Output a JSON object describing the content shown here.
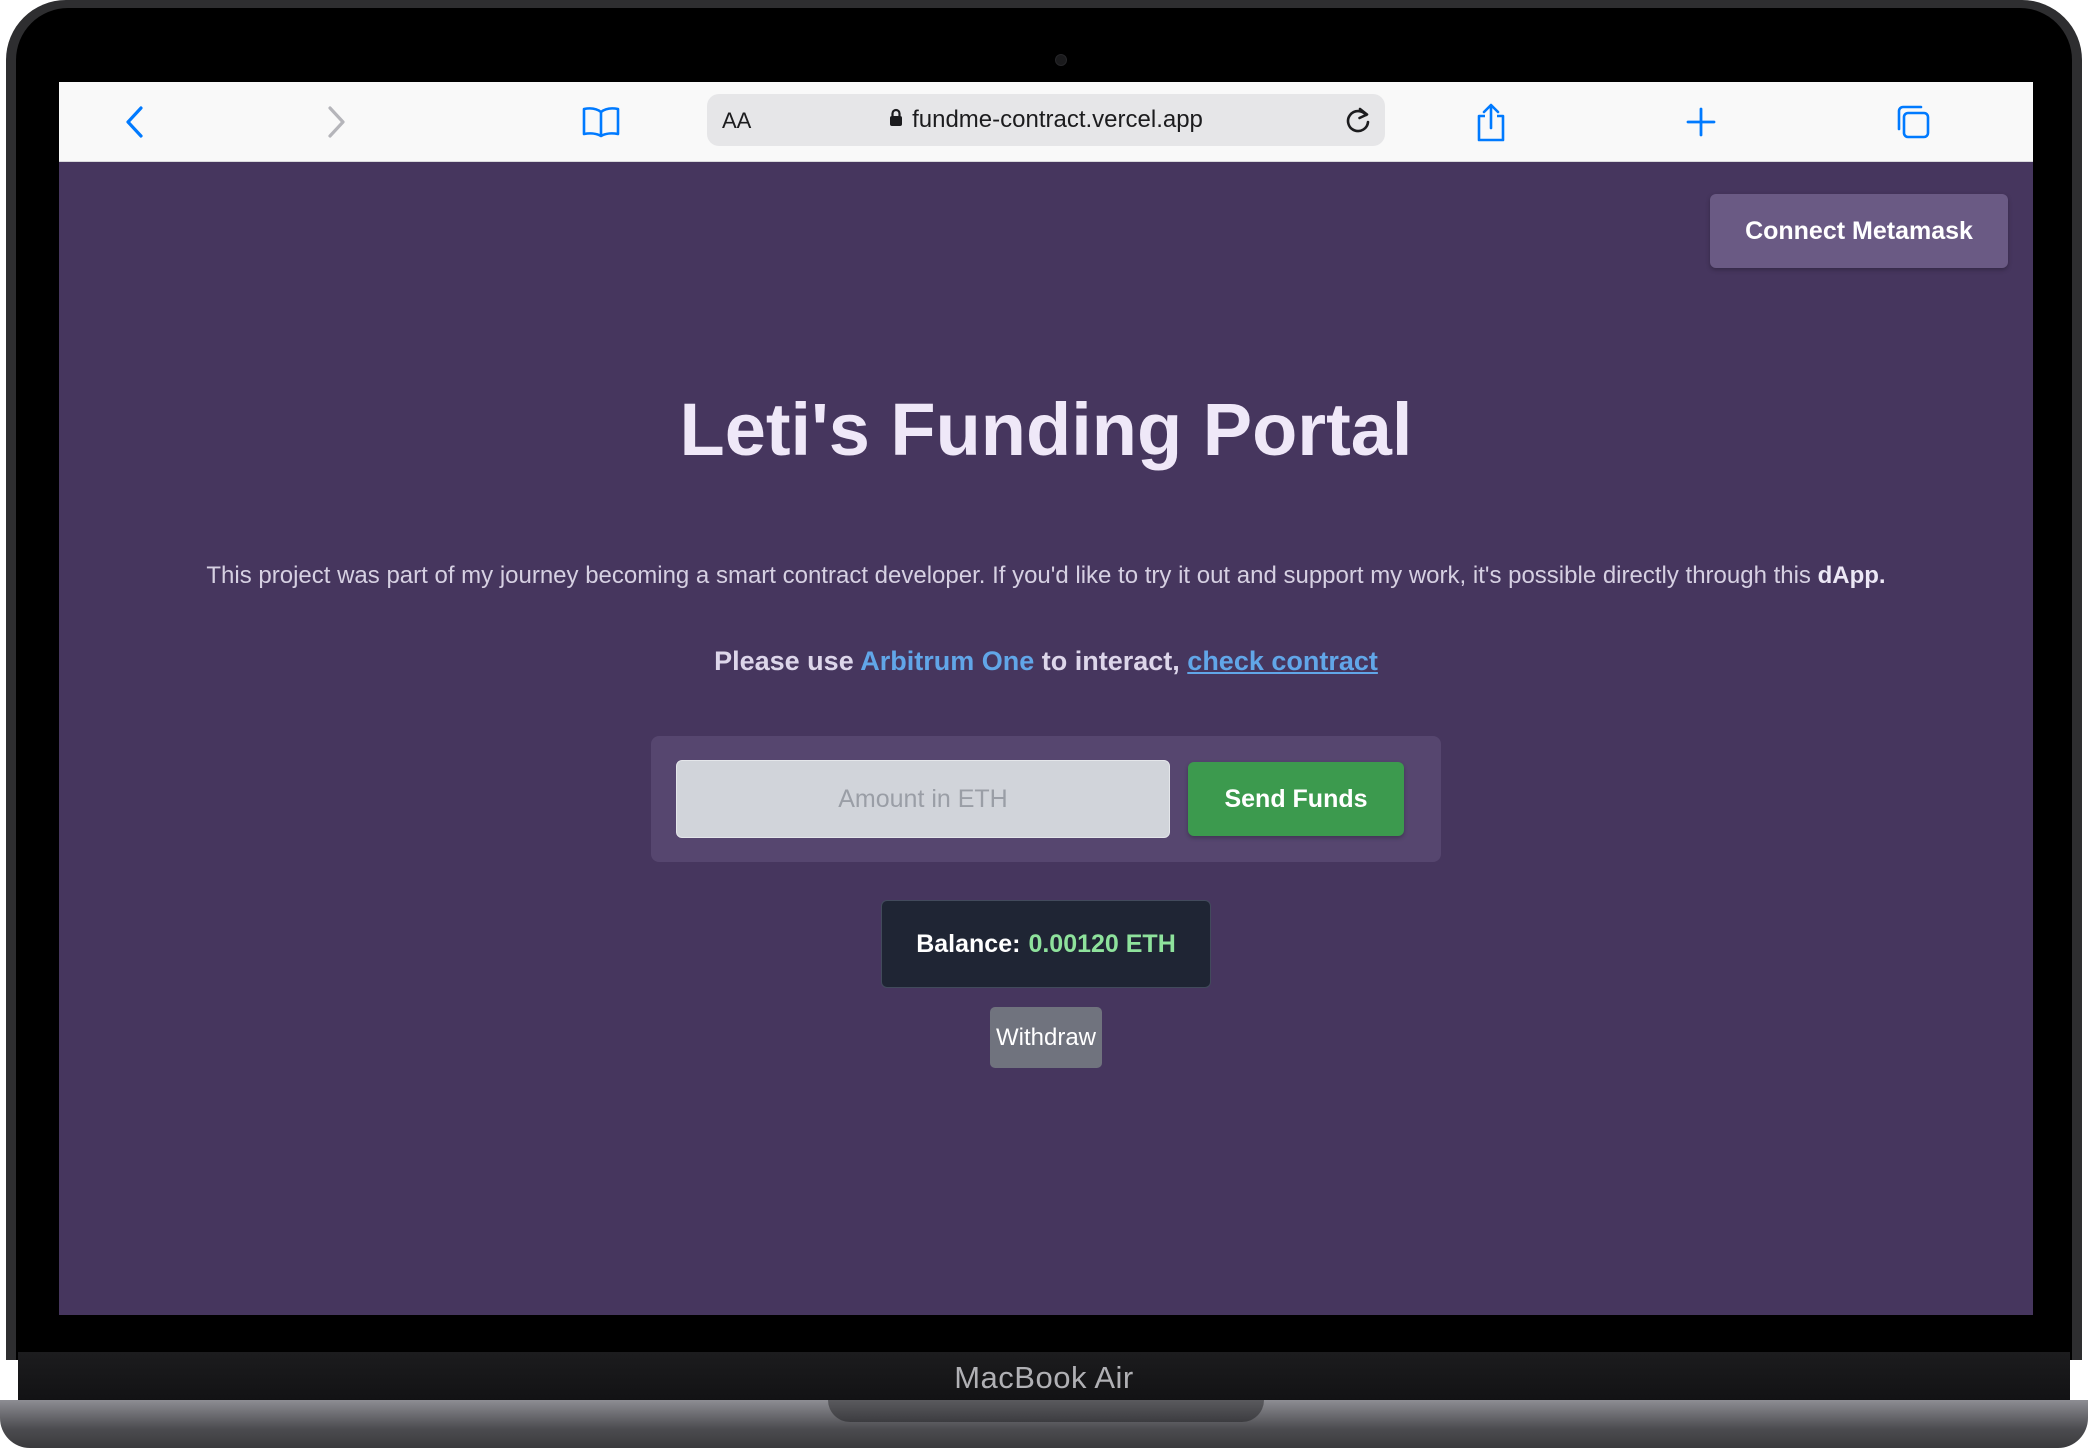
{
  "device": {
    "brand_label": "MacBook Air"
  },
  "browser": {
    "text_size_label": "AA",
    "url": "fundme-contract.vercel.app",
    "accent_color": "#007aff",
    "icons": {
      "back": "chevron-left-icon",
      "forward": "chevron-right-icon",
      "bookmarks": "book-icon",
      "lock": "lock-icon",
      "reload": "reload-icon",
      "share": "share-icon",
      "new_tab": "plus-icon",
      "tabs": "tabs-icon"
    }
  },
  "page": {
    "background_color": "#46365e",
    "connect_button_label": "Connect Metamask",
    "title": "Leti's Funding Portal",
    "description": "This project was part of my journey becoming a smart contract developer. If you'd like to try it out and support my work, it's possible directly through this",
    "description_emphasis": "dApp.",
    "network_prefix": "Please use",
    "network_name": "Arbitrum One",
    "network_middle": "to interact,",
    "contract_link": "check contract",
    "fund_form": {
      "amount_placeholder": "Amount in ETH",
      "amount_value": "",
      "send_button_label": "Send Funds",
      "send_button_color": "#3c9a4e"
    },
    "balance": {
      "label": "Balance:",
      "value": "0.00120 ETH",
      "value_color": "#8ee29c"
    },
    "withdraw_button_label": "Withdraw"
  }
}
